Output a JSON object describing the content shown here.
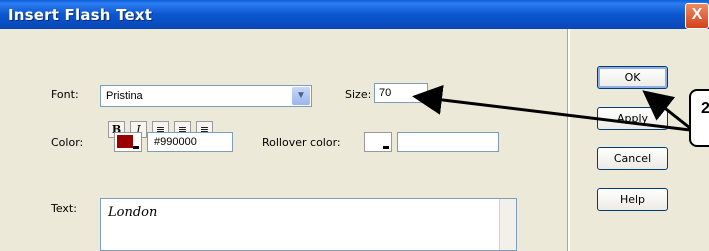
{
  "window": {
    "title": "Insert Flash Text",
    "close": "X"
  },
  "labels": {
    "font": "Font:",
    "size": "Size:",
    "color": "Color:",
    "rollover": "Rollover color:",
    "text": "Text:"
  },
  "font": {
    "value": "Pristina"
  },
  "size": {
    "value": "70"
  },
  "format": {
    "bold": "B",
    "italic": "I"
  },
  "color": {
    "hex": "#990000",
    "swatch": "#990000"
  },
  "text_value": "London",
  "buttons": {
    "ok": "OK",
    "apply": "Apply",
    "cancel": "Cancel",
    "help": "Help"
  },
  "callout": {
    "number": "2"
  }
}
